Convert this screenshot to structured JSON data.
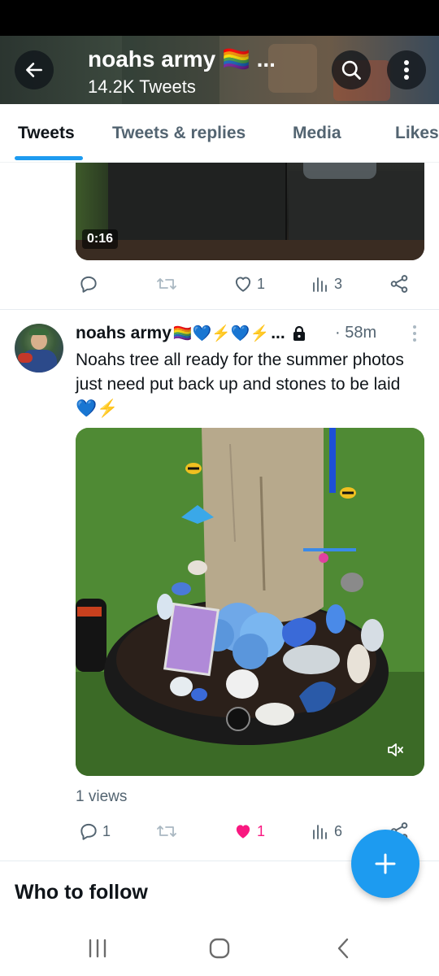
{
  "header": {
    "title": "noahs army 🏳️‍🌈 ...",
    "tweet_count": "14.2K Tweets"
  },
  "tabs": [
    {
      "label": "Tweets",
      "active": true
    },
    {
      "label": "Tweets & replies",
      "active": false
    },
    {
      "label": "Media",
      "active": false
    },
    {
      "label": "Likes",
      "active": false
    }
  ],
  "previous_tweet": {
    "video_duration": "0:16",
    "reply_count": "",
    "retweet_count": "",
    "like_count": "1",
    "view_count": "3"
  },
  "tweet": {
    "author_name": "noahs army",
    "name_emojis": "🏳️‍🌈💙⚡💙⚡",
    "name_ellipsis": "...",
    "time": "· 58m",
    "text": "Noahs tree all ready for the summer photos just need put back up and stones to be laid 💙⚡",
    "views_label": "1 views",
    "reply_count": "1",
    "retweet_count": "",
    "like_count": "1",
    "liked": true,
    "view_count": "6"
  },
  "who_to_follow": "Who to follow",
  "colors": {
    "accent": "#1d9bf0",
    "like": "#f91880",
    "secondary_text": "#536471"
  },
  "icons": [
    "back-arrow-icon",
    "search-icon",
    "more-vertical-icon",
    "reply-icon",
    "retweet-icon",
    "heart-icon",
    "analytics-icon",
    "share-icon",
    "lock-icon",
    "mute-icon",
    "plus-icon"
  ]
}
